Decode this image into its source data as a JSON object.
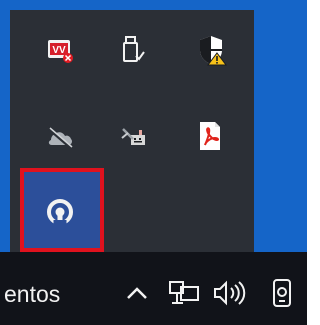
{
  "window": {
    "title": ""
  },
  "tray_overflow": {
    "icons": [
      {
        "icon": "virus-alert-icon",
        "state": "normal"
      },
      {
        "icon": "usb-drive-icon",
        "state": "normal"
      },
      {
        "icon": "security-shield-warning-icon",
        "state": "normal"
      },
      {
        "icon": "cloud-offline-icon",
        "state": "normal"
      },
      {
        "icon": "network-tool-icon",
        "state": "normal"
      },
      {
        "icon": "pdf-reader-icon",
        "state": "normal"
      },
      {
        "icon": "vpn-client-icon",
        "state": "highlighted"
      }
    ]
  },
  "taskbar": {
    "label": "entos",
    "icons": [
      "chevron-up-icon",
      "network-icon",
      "volume-icon",
      "camera-icon"
    ]
  },
  "colors": {
    "desktop": "#1565c8",
    "tray_background": "#2b2f36",
    "taskbar": "#111319",
    "highlight_border": "#e0121e",
    "highlight_fill": "#2c4f9a"
  }
}
